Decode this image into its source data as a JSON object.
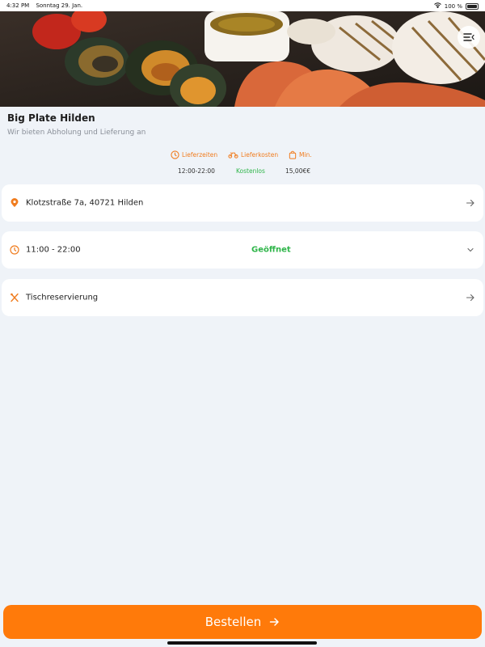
{
  "status_bar": {
    "time": "4:32 PM",
    "date": "Sonntag 29. Jan.",
    "battery": "100 %"
  },
  "restaurant": {
    "name": "Big Plate Hilden",
    "tagline": "Wir bieten Abholung und Lieferung an"
  },
  "delivery_info": [
    {
      "icon": "clock-icon",
      "label": "Lieferzeiten",
      "value": "12:00-22:00"
    },
    {
      "icon": "scooter-icon",
      "label": "Lieferkosten",
      "value": "Kostenlos"
    },
    {
      "icon": "bag-icon",
      "label": "Min.",
      "value": "15,00€€"
    }
  ],
  "cards": {
    "address": {
      "label": "Klotzstraße 7a, 40721 Hilden",
      "icon": "location-pin-icon"
    },
    "hours": {
      "label": "11:00 - 22:00",
      "status": "Geöffnet",
      "icon": "clock-icon"
    },
    "reservation": {
      "label": "Tischreservierung",
      "icon": "cutlery-icon"
    }
  },
  "order_button": {
    "label": "Bestellen"
  },
  "colors": {
    "accent": "#ff7a0a",
    "open": "#2fb54a",
    "background": "#eff3f8"
  }
}
